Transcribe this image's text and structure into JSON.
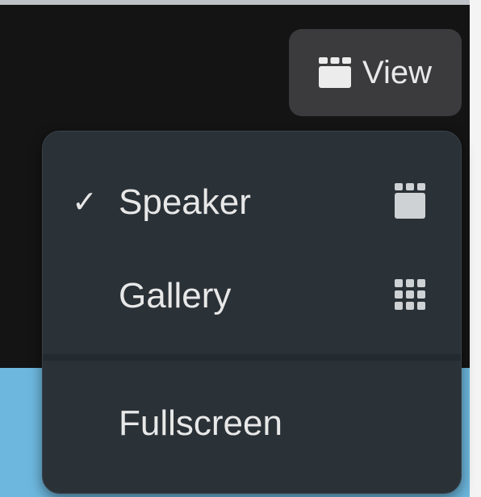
{
  "toolbar": {
    "view_label": "View",
    "view_icon": "speaker-layout-icon"
  },
  "menu": {
    "items": [
      {
        "label": "Speaker",
        "checked": true,
        "check_mark": "✓",
        "icon": "speaker-layout-icon"
      },
      {
        "label": "Gallery",
        "checked": false,
        "icon": "gallery-grid-icon"
      },
      {
        "label": "Fullscreen",
        "checked": false
      }
    ]
  },
  "colors": {
    "background_dark": "#141414",
    "background_blue": "#6db7de",
    "button_bg": "#3b3b3d",
    "menu_bg": "#2a3137",
    "text": "#e8e8e8"
  }
}
